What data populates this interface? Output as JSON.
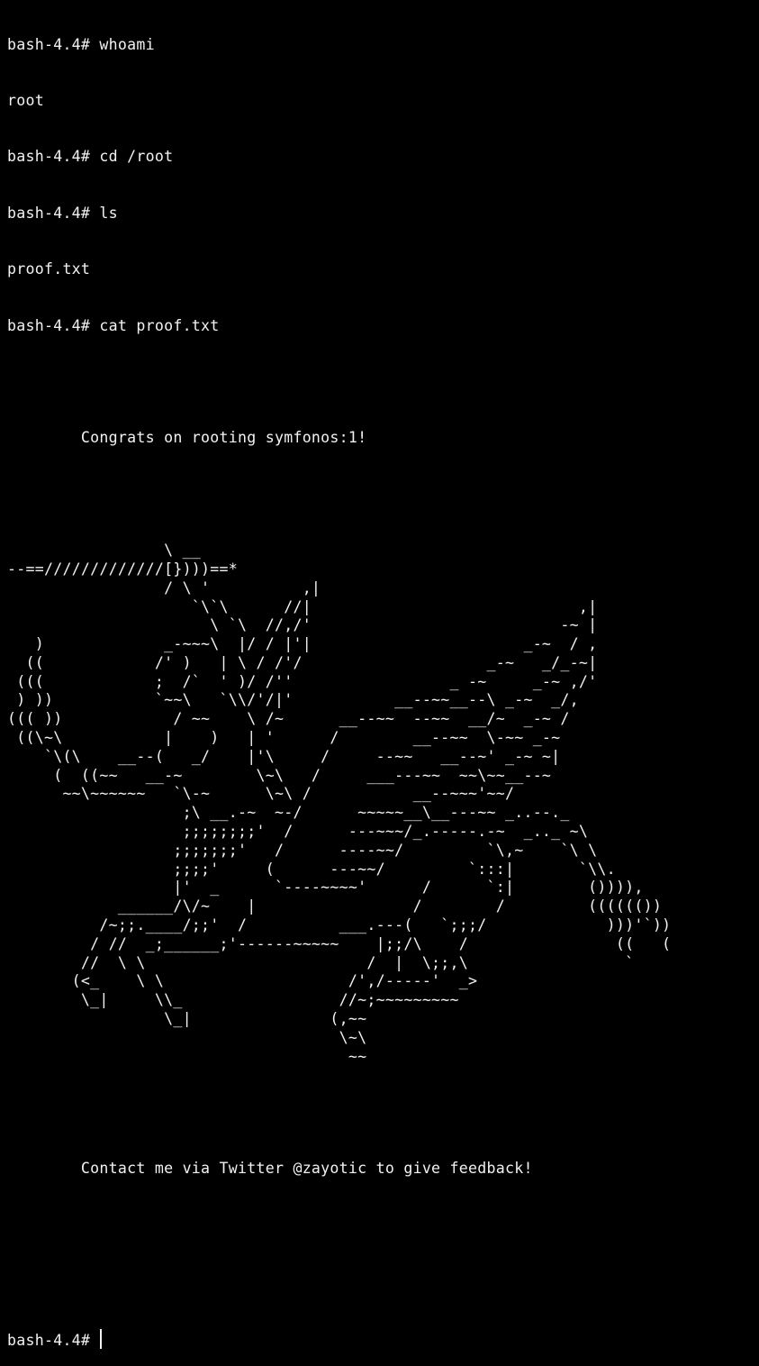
{
  "terminal": {
    "colors": {
      "background": "#000000",
      "foreground": "#f2f2f2"
    },
    "history": [
      "bash-4.4# whoami",
      "root",
      "bash-4.4# cd /root",
      "bash-4.4# ls",
      "proof.txt",
      "bash-4.4# cat proof.txt",
      "",
      "        Congrats on rooting symfonos:1!",
      ""
    ],
    "art": "                 \\ __\n--==/////////////[})))==*\n                 / \\ '          ,|\n                    `\\`\\      //|                             ,|\n                      \\ `\\  //,/'                           -~ |\n   )             _-~~~\\  |/ / |'|                       _-~  / ,\n  ((            /' )   | \\ / /'/                    _-~   _/_-~|\n (((            ;  /`  ' )/ /''                 _ -~     _-~ ,/'\n ) ))           `~~\\   `\\\\/'/|'           __--~~__--\\ _-~  _/,\n((( ))            / ~~    \\ /~      __--~~  --~~  __/~  _-~ /\n ((\\~\\           |    )   | '      /        __--~~  \\-~~ _-~\n    `\\(\\    __--(   _/    |'\\     /     --~~   __--~' _-~ ~|\n     (  ((~~   __-~        \\~\\   /     ___---~~  ~~\\~~__--~\n      ~~\\~~~~~~   `\\-~      \\~\\ /           __--~~~'~~/\n                   ;\\ __.-~  ~-/      ~~~~~__\\__---~~ _..--._\n                   ;;;;;;;;'  /      ---~~~/_.-----.-~  _.._ ~\\\n                  ;;;;;;;'   /      ----~~/         `\\,~    `\\ \\\n                  ;;;;'     (      ---~~/         `:::|       `\\\\.\n                  |'  _      `----~~~~'      /      `:|        ()))),\n            ______/\\/~    |                 /        /         (((((())\n          /~;;.____/;;'  /          ___.---(   `;;;/             )))'`))\n         / //  _;______;'------~~~~~    |;;/\\    /                ((   (\n        //  \\ \\                        /  |  \\;;,\\                 `\n       (<_    \\ \\                    /',/-----'  _>\n        \\_|     \\\\_                 //~;~~~~~~~~~\n                 \\_|               (,~~\n                                    \\~\\\n                                     ~~",
    "footer": [
      "",
      "        Contact me via Twitter @zayotic to give feedback!",
      "",
      ""
    ],
    "prompt": "bash-4.4# "
  }
}
